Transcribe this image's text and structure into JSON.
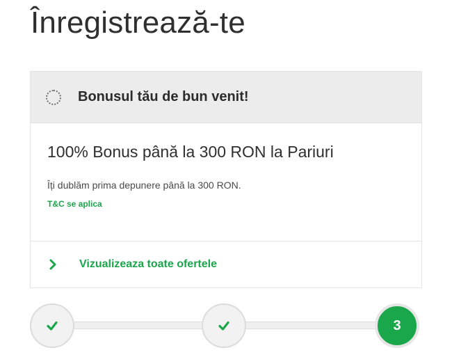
{
  "page": {
    "title": "Înregistrează-te"
  },
  "bonus_card": {
    "header_title": "Bonusul tău de bun venit!",
    "offer_title": "100% Bonus până la 300 RON la Pariuri",
    "offer_description": "Îți dublăm prima depunere până la 300 RON.",
    "terms_link": "T&C se aplica",
    "view_all_label": "Vizualizeaza toate ofertele"
  },
  "stepper": {
    "steps": [
      {
        "state": "completed",
        "icon": "check-icon"
      },
      {
        "state": "completed",
        "icon": "check-icon"
      },
      {
        "state": "current",
        "label": "3"
      }
    ]
  },
  "colors": {
    "accent": "#1aa64a",
    "header_bg": "#ececec"
  }
}
